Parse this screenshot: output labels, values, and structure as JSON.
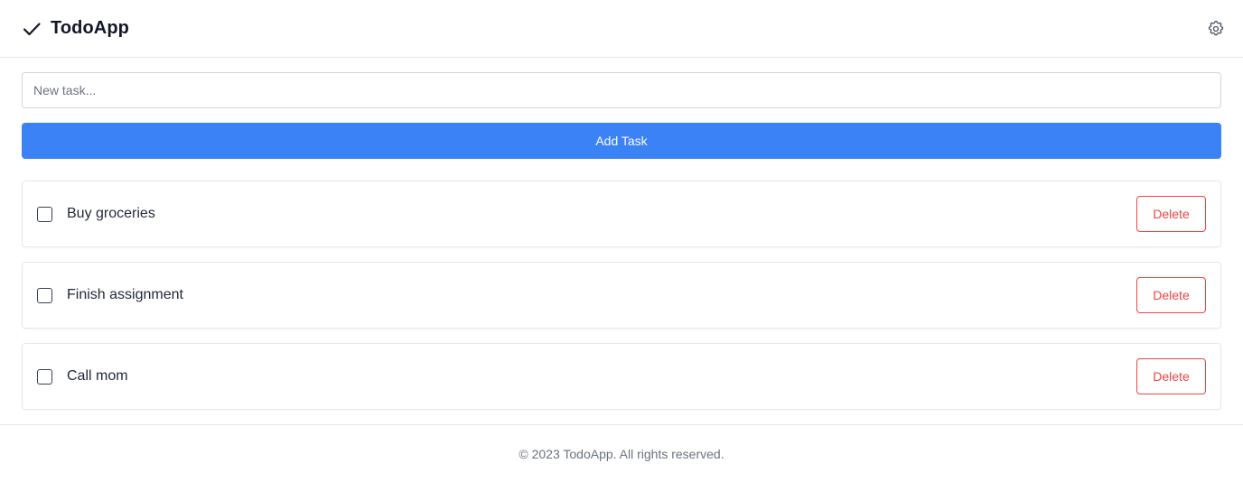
{
  "header": {
    "title": "TodoApp",
    "brand_icon": "check-icon",
    "settings_icon": "gear-icon"
  },
  "form": {
    "input_placeholder": "New task...",
    "input_value": "",
    "add_button_label": "Add Task"
  },
  "tasks": [
    {
      "label": "Buy groceries",
      "checked": false,
      "delete_label": "Delete"
    },
    {
      "label": "Finish assignment",
      "checked": false,
      "delete_label": "Delete"
    },
    {
      "label": "Call mom",
      "checked": false,
      "delete_label": "Delete"
    }
  ],
  "footer": {
    "text": "© 2023 TodoApp. All rights reserved."
  },
  "colors": {
    "accent": "#3b82f6",
    "danger": "#ef4444",
    "border": "#e5e7eb",
    "muted_text": "#6b7280"
  }
}
